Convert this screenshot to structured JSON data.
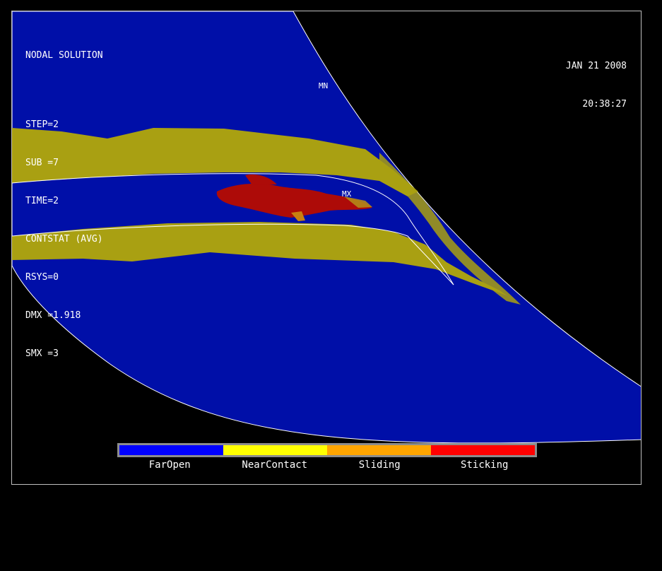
{
  "header": {
    "title": "NODAL SOLUTION",
    "lines": [
      "STEP=2",
      "SUB =7",
      "TIME=2",
      "CONTSTAT (AVG)",
      "RSYS=0",
      "DMX =1.918",
      "SMX =3"
    ]
  },
  "timestamp": {
    "date": "JAN 21 2008",
    "time": "20:38:27"
  },
  "markers": {
    "min": "MN",
    "max": "MX"
  },
  "legend": [
    {
      "label": "FarOpen",
      "color": "#0000ff"
    },
    {
      "label": "NearContact",
      "color": "#ffff00"
    },
    {
      "label": "Sliding",
      "color": "#ffa500"
    },
    {
      "label": "Sticking",
      "color": "#ff0000"
    }
  ],
  "colors": {
    "mesh_blue": "#000fa8",
    "band_olive": "#a9a012",
    "contact_red": "#ad0b08",
    "edge": "#ffffff"
  }
}
